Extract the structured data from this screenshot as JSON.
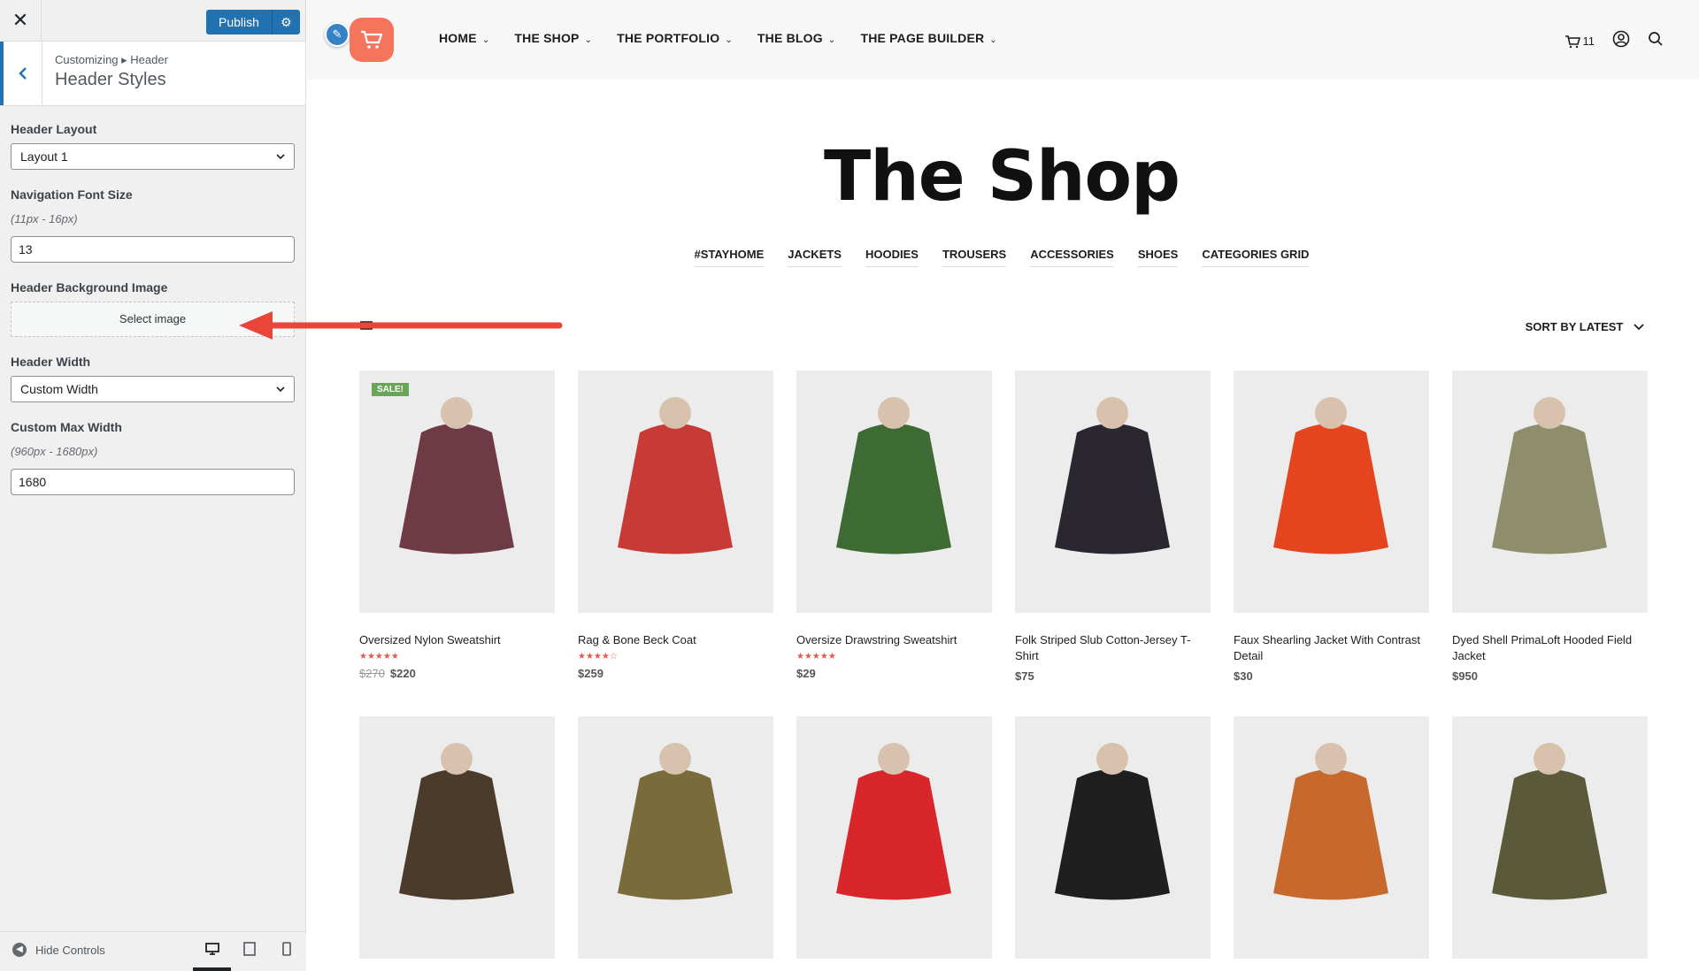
{
  "customizer": {
    "close_label": "✕",
    "publish_label": "Publish",
    "breadcrumb": "Customizing ▸ Header",
    "section_title": "Header Styles",
    "controls": {
      "header_layout": {
        "label": "Header Layout",
        "value": "Layout 1"
      },
      "nav_font_size": {
        "label": "Navigation Font Size",
        "desc": "(11px - 16px)",
        "value": "13"
      },
      "header_bg_image": {
        "label": "Header Background Image",
        "button": "Select image"
      },
      "header_width": {
        "label": "Header Width",
        "value": "Custom Width"
      },
      "custom_max_width": {
        "label": "Custom Max Width",
        "desc": "(960px - 1680px)",
        "value": "1680"
      }
    },
    "footer": {
      "hide_controls": "Hide Controls",
      "active_device": "desktop"
    }
  },
  "site": {
    "nav": [
      "HOME",
      "THE SHOP",
      "THE PORTFOLIO",
      "THE BLOG",
      "THE PAGE BUILDER"
    ],
    "cart_count": "11",
    "title": "The Shop",
    "categories": [
      "#STAYHOME",
      "JACKETS",
      "HOODIES",
      "TROUSERS",
      "ACCESSORIES",
      "SHOES",
      "CATEGORIES GRID"
    ],
    "sort_label": "SORT BY LATEST",
    "products": [
      {
        "name": "Oversized Nylon Sweatshirt",
        "price": "$220",
        "old_price": "$270",
        "rating": 5,
        "sale": "SALE!",
        "color": "#6e3a45"
      },
      {
        "name": "Rag & Bone Beck Coat",
        "price": "$259",
        "rating": 4,
        "color": "#c83a36"
      },
      {
        "name": "Oversize Drawstring Sweatshirt",
        "price": "$29",
        "rating": 5,
        "color": "#3e6b34"
      },
      {
        "name": "Folk Striped Slub Cotton-Jersey T-Shirt",
        "price": "$75",
        "color": "#2a2730"
      },
      {
        "name": "Faux Shearling Jacket With Contrast Detail",
        "price": "$30",
        "color": "#e5451e"
      },
      {
        "name": "Dyed Shell PrimaLoft Hooded Field Jacket",
        "price": "$950",
        "color": "#8e8e6d"
      },
      {
        "color": "#4b3b2b"
      },
      {
        "color": "#7a6b3a"
      },
      {
        "color": "#d8262b"
      },
      {
        "color": "#1f1f1f"
      },
      {
        "color": "#c7682d"
      },
      {
        "color": "#5a5a3a"
      }
    ]
  },
  "colors": {
    "accent": "#2271b1",
    "logo": "#f4745c",
    "stars": "#e0594a",
    "arrow": "#e8463a"
  }
}
